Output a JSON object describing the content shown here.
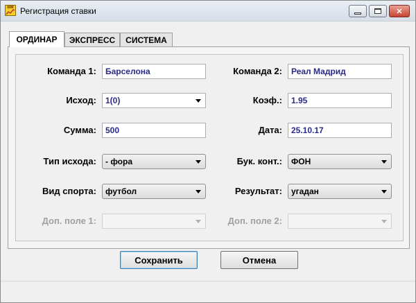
{
  "window": {
    "title": "Регистрация ставки",
    "app_icon_text": "BM"
  },
  "titlebar_buttons": {
    "minimize_glyph": "▭",
    "maximize_glyph": "▢",
    "close_glyph": "✕"
  },
  "tabs": [
    {
      "label": "ОРДИНАР",
      "active": true
    },
    {
      "label": "ЭКСПРЕСС",
      "active": false
    },
    {
      "label": "СИСТЕМА",
      "active": false
    }
  ],
  "form": {
    "team1": {
      "label": "Команда 1:",
      "value": "Барселона"
    },
    "team2": {
      "label": "Команда 2:",
      "value": "Реал Мадрид"
    },
    "outcome": {
      "label": "Исход:",
      "value": "1(0)"
    },
    "coef": {
      "label": "Коэф.:",
      "value": "1.95"
    },
    "amount": {
      "label": "Сумма:",
      "value": "500"
    },
    "date": {
      "label": "Дата:",
      "value": "25.10.17"
    },
    "outcome_type": {
      "label": "Тип исхода:",
      "value": "- фора"
    },
    "bookmaker": {
      "label": "Бук. конт.:",
      "value": "ФОН"
    },
    "sport": {
      "label": "Вид спорта:",
      "value": "футбол"
    },
    "result": {
      "label": "Результат:",
      "value": "угадан"
    },
    "extra1": {
      "label": "Доп. поле 1:",
      "value": ""
    },
    "extra2": {
      "label": "Доп. поле 2:",
      "value": ""
    }
  },
  "buttons": {
    "save": "Сохранить",
    "cancel": "Отмена"
  },
  "colors": {
    "value_text": "#2a2a8a",
    "disabled_text": "#a0a0a0",
    "close_button": "#c84331"
  }
}
